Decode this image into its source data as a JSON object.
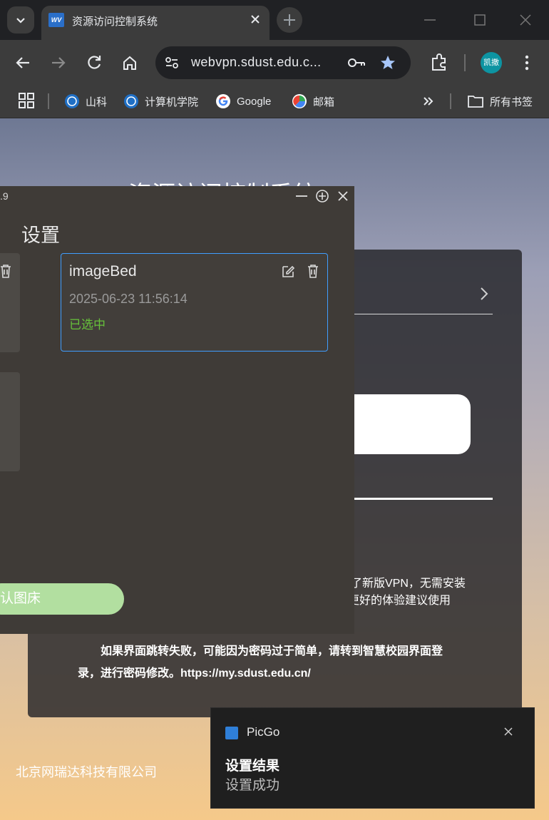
{
  "browser": {
    "tab_title": "资源访问控制系统",
    "favicon_text": "WV",
    "url": "webvpn.sdust.edu.c...",
    "profile_label": "凯撒",
    "bookmarks": [
      "山科",
      "计算机学院",
      "Google",
      "邮箱"
    ],
    "all_bookmarks": "所有书签"
  },
  "page": {
    "title": "资源访问控制系统",
    "notice_fragment_1": "了新版VPN，无需安装",
    "notice_fragment_2": "更好的体验建议使用",
    "notice_paragraph": "如果界面跳转失败，可能因为密码过于简单，请转到智慧校园界面登录，进行密码修改。https://my.sdust.edu.cn/",
    "company": "北京网瑞达科技有限公司"
  },
  "picgo": {
    "version_fragment": ".9",
    "heading": "设置",
    "card": {
      "name": "imageBed",
      "time": "2025-06-23 11:56:14",
      "status": "已选中"
    },
    "default_button": "认图床"
  },
  "toast": {
    "app": "PicGo",
    "title": "设置结果",
    "body": "设置成功"
  },
  "colors": {
    "selected_border": "#409eff",
    "selected_status": "#67c23a",
    "default_button": "#b2dfa0",
    "profile": "#0d94a2"
  }
}
